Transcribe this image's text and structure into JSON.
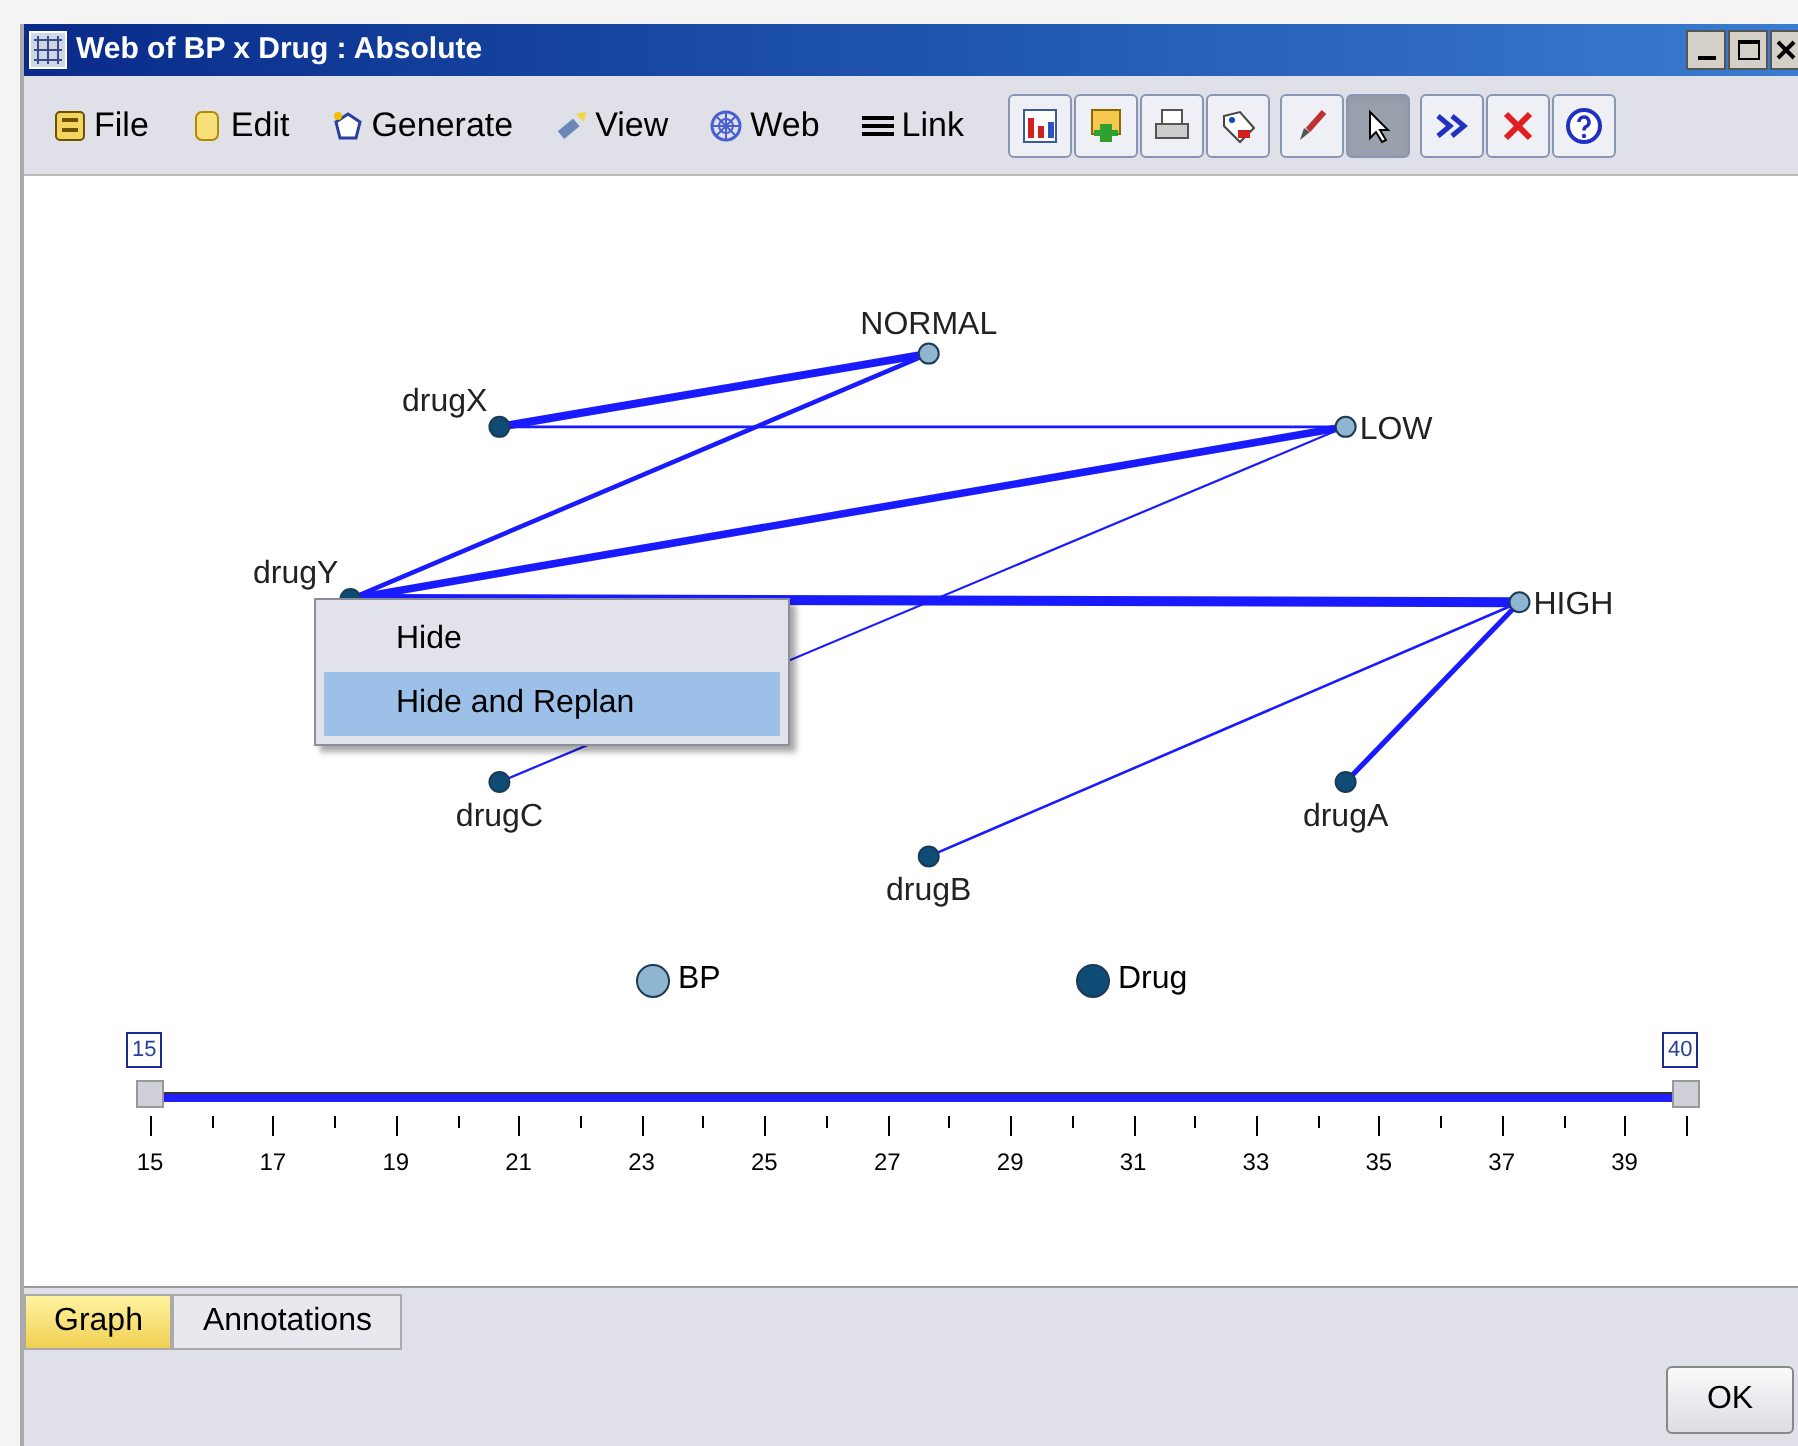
{
  "window": {
    "title": "Web of BP x Drug : Absolute"
  },
  "menus": [
    {
      "label": "File"
    },
    {
      "label": "Edit"
    },
    {
      "label": "Generate"
    },
    {
      "label": "View"
    },
    {
      "label": "Web"
    },
    {
      "label": "Link"
    }
  ],
  "tools": [
    {
      "selected": false
    },
    {
      "selected": false
    },
    {
      "selected": false
    },
    {
      "selected": false
    },
    {
      "selected": false
    },
    {
      "selected": true
    },
    {
      "selected": false
    },
    {
      "selected": false
    },
    {
      "selected": false
    }
  ],
  "graph": {
    "nodes": [
      {
        "label": "NORMAL",
        "kind": "bp"
      },
      {
        "label": "LOW",
        "kind": "bp"
      },
      {
        "label": "HIGH",
        "kind": "bp"
      },
      {
        "label": "drugX",
        "kind": "drug"
      },
      {
        "label": "drugY",
        "kind": "drug"
      },
      {
        "label": "drugC",
        "kind": "drug"
      },
      {
        "label": "drugB",
        "kind": "drug"
      },
      {
        "label": "drugA",
        "kind": "drug"
      }
    ],
    "legend": [
      {
        "label": "BP",
        "kind": "bp"
      },
      {
        "label": "Drug",
        "kind": "drug"
      }
    ]
  },
  "context_menu": {
    "items": [
      {
        "label": "Hide",
        "selected": false
      },
      {
        "label": "Hide and Replan",
        "selected": true
      }
    ]
  },
  "slider": {
    "handles": [
      {
        "label": "15",
        "level": 0
      },
      {
        "label": "40",
        "level": 1
      }
    ],
    "tick_labels": [
      "15",
      "17",
      "19",
      "21",
      "23",
      "25",
      "27",
      "29",
      "31",
      "33",
      "35",
      "37",
      "39"
    ]
  },
  "tabs": [
    {
      "label": "Graph",
      "selected": true
    },
    {
      "label": "Annotations",
      "selected": false
    }
  ],
  "buttons": [
    "OK"
  ]
}
